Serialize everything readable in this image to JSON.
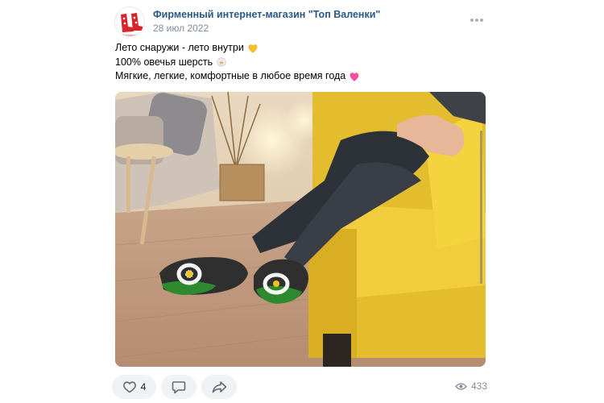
{
  "post": {
    "author": "Фирменный интернет-магазин \"Топ Валенки\"",
    "date": "28 июл 2022",
    "avatar_text": "TopValenki",
    "lines": [
      {
        "text": "Лето снаружи - лето внутри",
        "emoji": "yellow-heart"
      },
      {
        "text": "100% овечья шерсть",
        "emoji": "sheep"
      },
      {
        "text": "Мягкие, легкие, комфортные в любое время года",
        "emoji": "sparkling-heart"
      }
    ],
    "photo": {
      "description_icon": "photo-felt-slippers"
    }
  },
  "actions": {
    "like_count": "4",
    "views_count": "433"
  },
  "colors": {
    "link": "#2a5885",
    "muted": "#818c99",
    "action_bg": "#f0f2f5",
    "accent_red": "#d9242b"
  }
}
